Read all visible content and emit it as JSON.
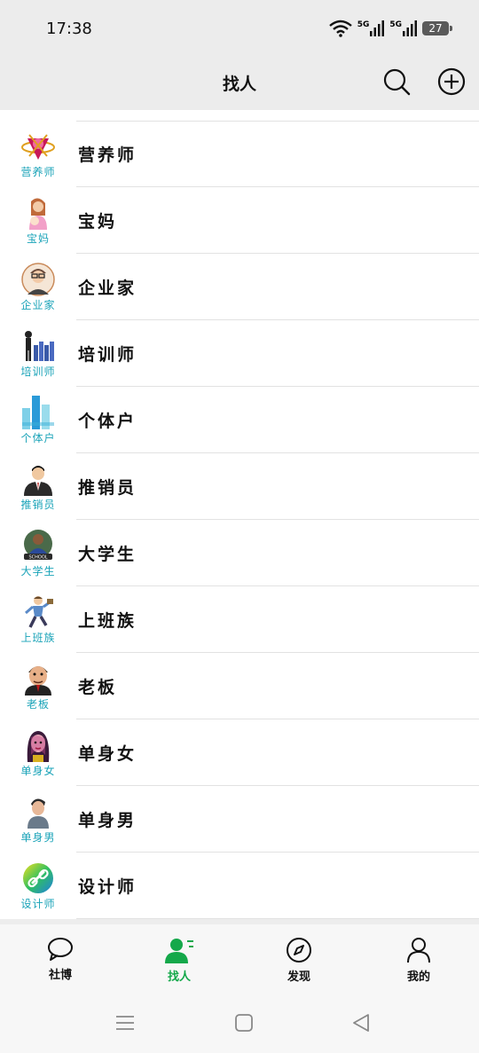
{
  "status": {
    "time": "17:38",
    "net1": "5G",
    "net2": "5G",
    "battery": "27"
  },
  "header": {
    "title": "找人"
  },
  "list": [
    {
      "label": "营养师",
      "avatar_label": "营养师",
      "icon": "nutritionist-icon"
    },
    {
      "label": "宝妈",
      "avatar_label": "宝妈",
      "icon": "mother-baby-icon"
    },
    {
      "label": "企业家",
      "avatar_label": "企业家",
      "icon": "entrepreneur-icon"
    },
    {
      "label": "培训师",
      "avatar_label": "培训师",
      "icon": "trainer-icon"
    },
    {
      "label": "个体户",
      "avatar_label": "个体户",
      "icon": "self-employed-icon"
    },
    {
      "label": "推销员",
      "avatar_label": "推销员",
      "icon": "salesman-icon"
    },
    {
      "label": "大学生",
      "avatar_label": "大学生",
      "icon": "college-student-icon"
    },
    {
      "label": "上班族",
      "avatar_label": "上班族",
      "icon": "office-worker-icon"
    },
    {
      "label": "老板",
      "avatar_label": "老板",
      "icon": "boss-icon"
    },
    {
      "label": "单身女",
      "avatar_label": "单身女",
      "icon": "single-woman-icon"
    },
    {
      "label": "单身男",
      "avatar_label": "单身男",
      "icon": "single-man-icon"
    },
    {
      "label": "设计师",
      "avatar_label": "设计师",
      "icon": "designer-icon"
    }
  ],
  "tabs": [
    {
      "label": "社博",
      "icon": "chat-bubble-icon"
    },
    {
      "label": "找人",
      "icon": "find-people-icon",
      "active": true
    },
    {
      "label": "发现",
      "icon": "compass-icon"
    },
    {
      "label": "我的",
      "icon": "person-icon"
    }
  ],
  "colors": {
    "accent": "#14a84a",
    "avatar_label": "#1aa3b8",
    "header_bg": "#ececec"
  }
}
